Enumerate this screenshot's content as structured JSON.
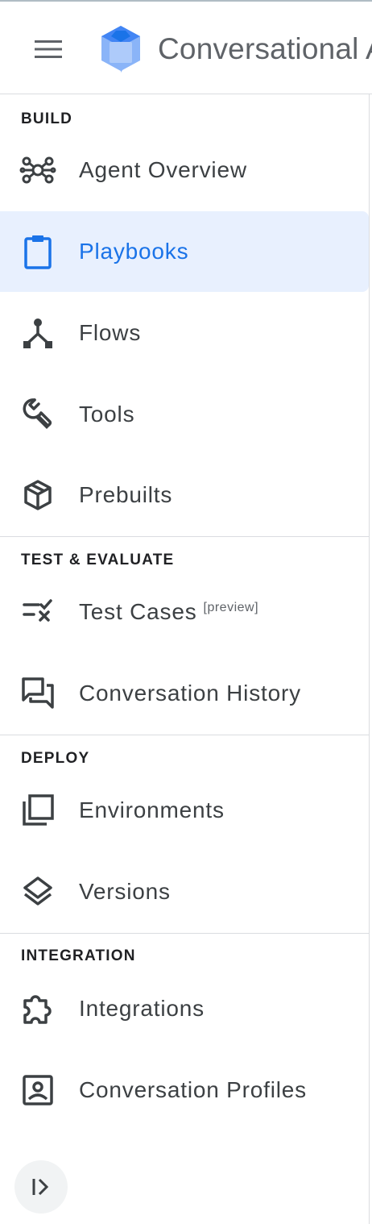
{
  "app": {
    "title": "Conversational Agents"
  },
  "icons": {
    "menu": "hamburger-menu-icon",
    "logo": "conversational-agents-logo",
    "collapse": "collapse-sidebar-icon"
  },
  "colors": {
    "active_bg": "#e8f0fe",
    "active_fg": "#1a73e8",
    "text": "#3c4043"
  },
  "sidebar": {
    "sections": [
      {
        "header": "BUILD",
        "items": [
          {
            "label": "Agent Overview",
            "icon": "hub-icon",
            "active": false
          },
          {
            "label": "Playbooks",
            "icon": "clipboard-icon",
            "active": true
          },
          {
            "label": "Flows",
            "icon": "flow-icon",
            "active": false
          },
          {
            "label": "Tools",
            "icon": "wrench-icon",
            "active": false
          },
          {
            "label": "Prebuilts",
            "icon": "package-icon",
            "active": false
          }
        ]
      },
      {
        "header": "TEST & EVALUATE",
        "items": [
          {
            "label": "Test Cases",
            "badge": "[preview]",
            "icon": "checklist-icon",
            "active": false
          },
          {
            "label": "Conversation History",
            "icon": "forum-icon",
            "active": false
          }
        ]
      },
      {
        "header": "DEPLOY",
        "items": [
          {
            "label": "Environments",
            "icon": "library-icon",
            "active": false
          },
          {
            "label": "Versions",
            "icon": "layers-icon",
            "active": false
          }
        ]
      },
      {
        "header": "INTEGRATION",
        "items": [
          {
            "label": "Integrations",
            "icon": "extension-icon",
            "active": false
          },
          {
            "label": "Conversation Profiles",
            "icon": "contact-card-icon",
            "active": false
          }
        ]
      }
    ]
  }
}
